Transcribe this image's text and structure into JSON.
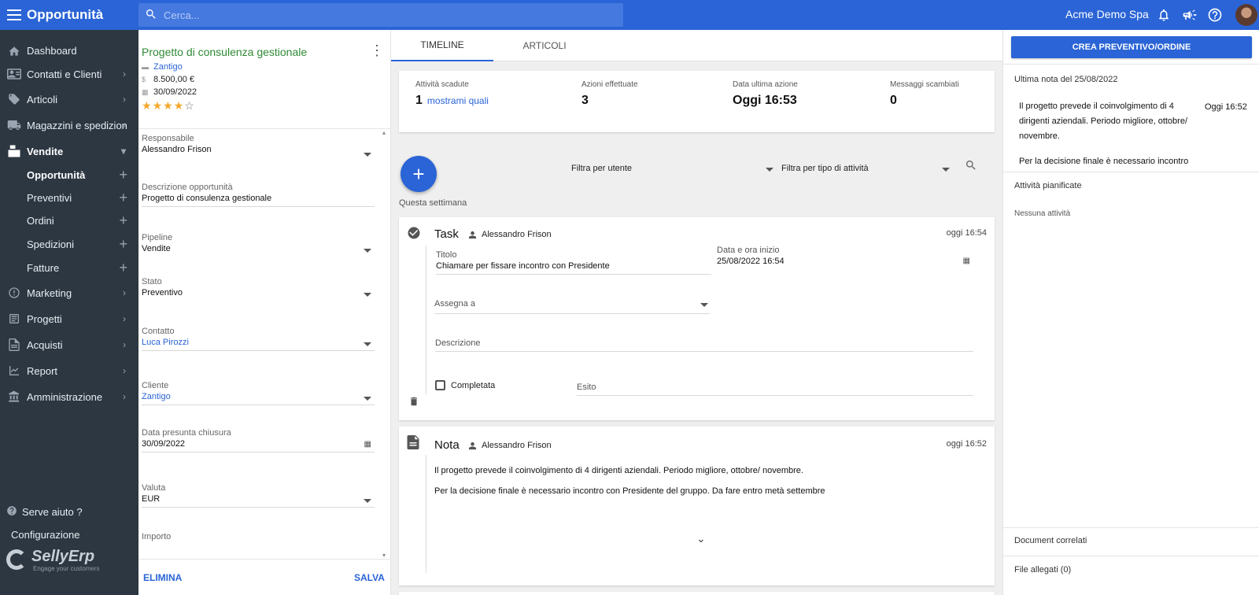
{
  "topbar": {
    "app_title": "Opportunità",
    "search_placeholder": "Cerca...",
    "company": "Acme Demo Spa"
  },
  "sidebar": {
    "items": [
      {
        "label": "Dashboard",
        "icon": "home-icon"
      },
      {
        "label": "Contatti e Clienti",
        "icon": "contacts-icon"
      },
      {
        "label": "Articoli",
        "icon": "tag-icon"
      },
      {
        "label": "Magazzini e spedizion",
        "icon": "truck-icon"
      },
      {
        "label": "Vendite",
        "icon": "register-icon"
      },
      {
        "label": "Marketing",
        "icon": "marketing-icon"
      },
      {
        "label": "Progetti",
        "icon": "projects-icon"
      },
      {
        "label": "Acquisti",
        "icon": "purchases-icon"
      },
      {
        "label": "Report",
        "icon": "chart-icon"
      },
      {
        "label": "Amministrazione",
        "icon": "bank-icon"
      }
    ],
    "vendite_sub": [
      "Opportunità",
      "Preventivi",
      "Ordini",
      "Spedizioni",
      "Fatture"
    ],
    "help": "Serve aiuto ?",
    "config": "Configurazione",
    "brand": "SellyErp",
    "tagline": "Engage your customers"
  },
  "details": {
    "title": "Progetto di consulenza gestionale",
    "company": "Zantigo",
    "amount": "8.500,00 €",
    "date": "30/09/2022",
    "rating": 4,
    "rating_max": 5,
    "fields": {
      "responsabile": {
        "label": "Responsabile",
        "value": "Alessandro Frison"
      },
      "descrizione": {
        "label": "Descrizione opportunità",
        "value": "Progetto di consulenza gestionale"
      },
      "pipeline": {
        "label": "Pipeline",
        "value": "Vendite"
      },
      "stato": {
        "label": "Stato",
        "value": "Preventivo"
      },
      "contatto": {
        "label": "Contatto",
        "value": "Luca Pirozzi"
      },
      "cliente": {
        "label": "Cliente",
        "value": "Zantigo"
      },
      "chiusura": {
        "label": "Data presunta chiusura",
        "value": "30/09/2022"
      },
      "valuta": {
        "label": "Valuta",
        "value": "EUR"
      },
      "importo": {
        "label": "Importo",
        "value": ""
      }
    },
    "delete_label": "ELIMINA",
    "save_label": "SALVA"
  },
  "center": {
    "tabs": [
      "TIMELINE",
      "ARTICOLI"
    ],
    "stats": [
      {
        "label": "Attività scadute",
        "value": "1",
        "link": "mostrami quali"
      },
      {
        "label": "Azioni effettuate",
        "value": "3"
      },
      {
        "label": "Data ultima azione",
        "value": "Oggi 16:53"
      },
      {
        "label": "Messaggi scambiati",
        "value": "0"
      }
    ],
    "filter_user": "Filtra per utente",
    "filter_type": "Filtra per tipo di attività",
    "week_label": "Questa settimana",
    "task": {
      "type": "Task",
      "user": "Alessandro Frison",
      "time": "oggi 16:54",
      "titolo_label": "Titolo",
      "titolo_value": "Chiamare per fissare incontro con Presidente",
      "data_label": "Data e ora inizio",
      "data_value": "25/08/2022 16:54",
      "assegna_label": "Assegna a",
      "descrizione_label": "Descrizione",
      "completata_label": "Completata",
      "esito_label": "Esito"
    },
    "nota": {
      "type": "Nota",
      "user": "Alessandro Frison",
      "time": "oggi 16:52",
      "line1": "Il progetto prevede il coinvolgimento di 4 dirigenti aziendali. Periodo migliore, ottobre/ novembre.",
      "line2": "Per la decisione finale è necessario incontro con Presidente del gruppo. Da fare entro metà settembre"
    }
  },
  "right": {
    "cta": "CREA PREVENTIVO/ORDINE",
    "last_note_label": "Ultima nota del 25/08/2022",
    "note_line1": "Il progetto prevede il coinvolgimento di 4 dirigenti aziendali. Periodo migliore, ottobre/ novembre.",
    "note_line2": "Per la decisione finale è necessario incontro",
    "note_time": "Oggi 16:52",
    "planned_label": "Attività pianificate",
    "no_activity": "Nessuna attività",
    "docs_label": "Document correlati",
    "files_label": "File allegati (0)"
  },
  "colors": {
    "primary": "#2a64d6",
    "sidebar_bg": "#2c3742",
    "title_green": "#2f8a35",
    "star": "#f4a72a"
  }
}
